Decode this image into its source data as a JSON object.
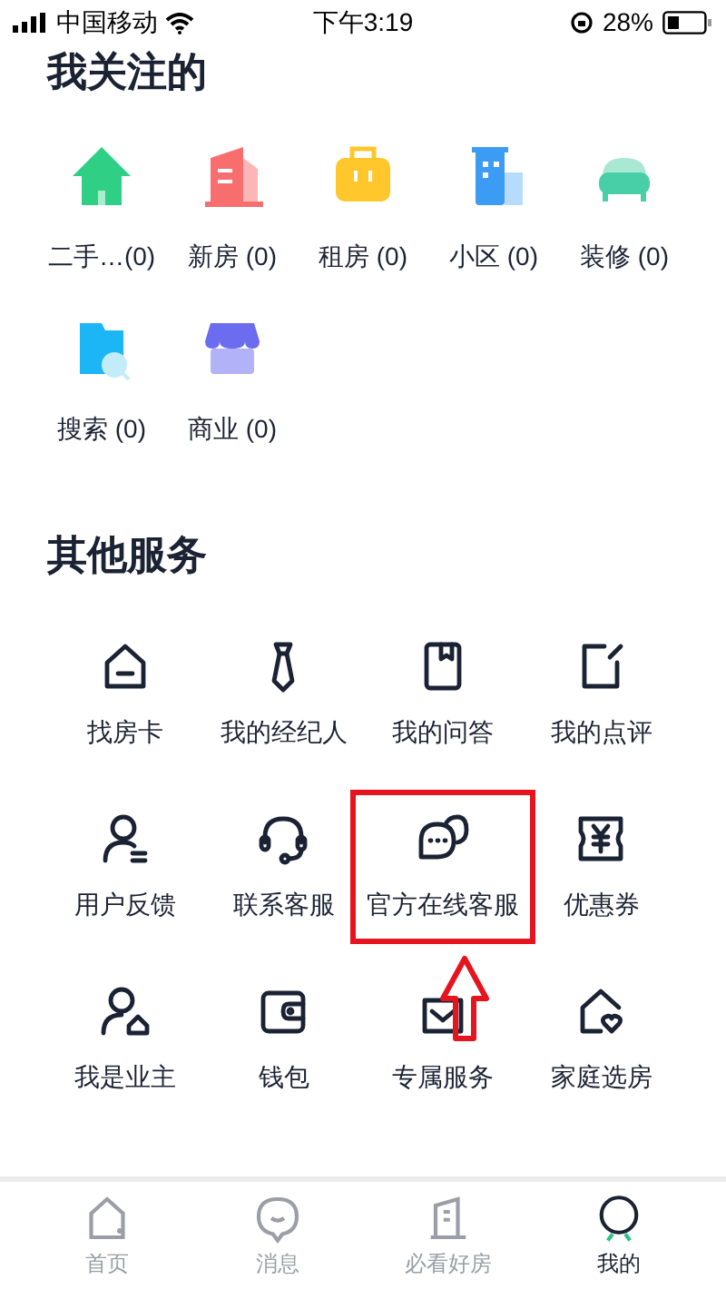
{
  "status_bar": {
    "carrier": "中国移动",
    "time": "下午3:19",
    "battery": "28%"
  },
  "following": {
    "title": "我关注的",
    "items": [
      {
        "label": "二手…(0)"
      },
      {
        "label": "新房 (0)"
      },
      {
        "label": "租房 (0)"
      },
      {
        "label": "小区 (0)"
      },
      {
        "label": "装修 (0)"
      },
      {
        "label": "搜索 (0)"
      },
      {
        "label": "商业 (0)"
      }
    ]
  },
  "services": {
    "title": "其他服务",
    "items": [
      {
        "label": "找房卡",
        "highlighted": false
      },
      {
        "label": "我的经纪人",
        "highlighted": false
      },
      {
        "label": "我的问答",
        "highlighted": false
      },
      {
        "label": "我的点评",
        "highlighted": false
      },
      {
        "label": "用户反馈",
        "highlighted": false
      },
      {
        "label": "联系客服",
        "highlighted": false
      },
      {
        "label": "官方在线客服",
        "highlighted": true
      },
      {
        "label": "优惠券",
        "highlighted": false
      },
      {
        "label": "我是业主",
        "highlighted": false
      },
      {
        "label": "钱包",
        "highlighted": false
      },
      {
        "label": "专属服务",
        "highlighted": false
      },
      {
        "label": "家庭选房",
        "highlighted": false
      }
    ]
  },
  "tab_bar": [
    {
      "label": "首页",
      "selected": false
    },
    {
      "label": "消息",
      "selected": false
    },
    {
      "label": "必看好房",
      "selected": false
    },
    {
      "label": "我的",
      "selected": true
    }
  ]
}
